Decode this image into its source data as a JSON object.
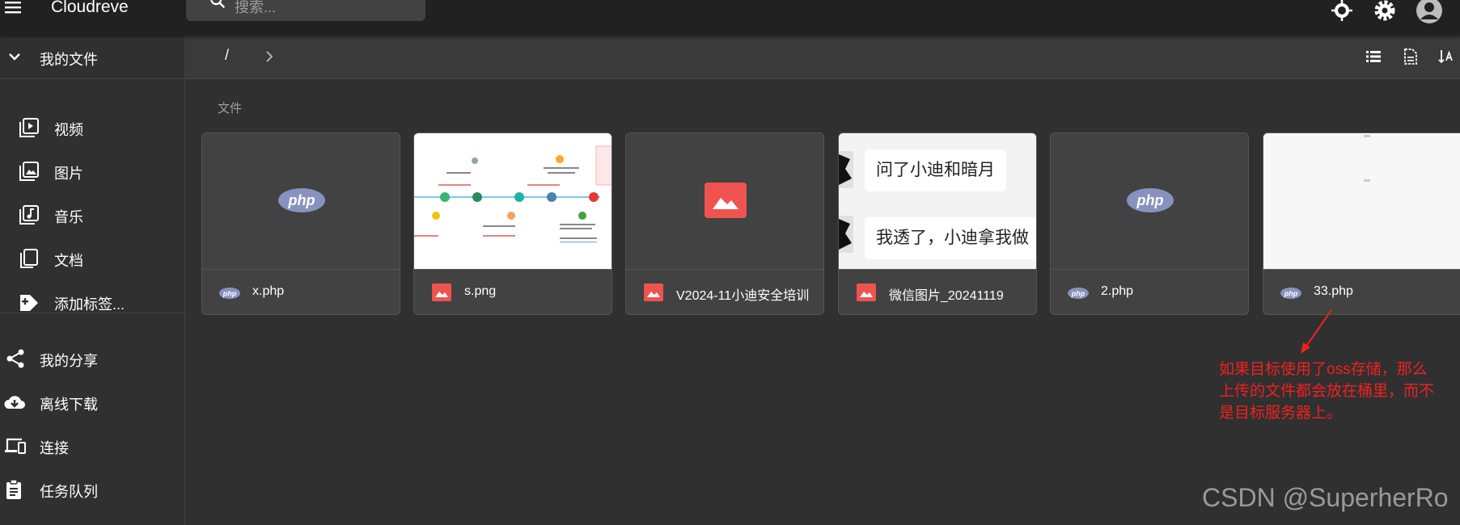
{
  "app": {
    "title": "Cloudreve"
  },
  "search": {
    "placeholder": "搜索..."
  },
  "sidebar": {
    "my_files": "我的文件",
    "categories": [
      {
        "label": "视频",
        "icon": "video-icon"
      },
      {
        "label": "图片",
        "icon": "image-icon"
      },
      {
        "label": "音乐",
        "icon": "music-icon"
      },
      {
        "label": "文档",
        "icon": "document-icon"
      },
      {
        "label": "添加标签...",
        "icon": "add-tag-icon"
      }
    ],
    "links": [
      {
        "label": "我的分享",
        "icon": "share-icon"
      },
      {
        "label": "离线下载",
        "icon": "cloud-download-icon"
      },
      {
        "label": "连接",
        "icon": "devices-icon"
      },
      {
        "label": "任务队列",
        "icon": "clipboard-icon"
      }
    ]
  },
  "toolbar": {
    "path": "/"
  },
  "files": {
    "section_label": "文件",
    "items": [
      {
        "name": "x.php",
        "type": "php"
      },
      {
        "name": "s.png",
        "type": "image"
      },
      {
        "name": "V2024-11小迪安全培训",
        "type": "image"
      },
      {
        "name": "微信图片_20241119",
        "type": "image"
      },
      {
        "name": "2.php",
        "type": "php"
      },
      {
        "name": "33.php",
        "type": "php"
      }
    ]
  },
  "chat_preview": {
    "line1": "问了小迪和暗月",
    "line2": "我透了，小迪拿我做"
  },
  "php_logo_text": "php",
  "annotation": {
    "text": "如果目标使用了oss存储，那么上传的文件都会放在桶里，而不是目标服务器上。"
  },
  "watermark": "CSDN @SuperherRo",
  "colors": {
    "appbar": "#212121",
    "background": "#303030",
    "card": "#424242",
    "image_icon": "#ef5350",
    "php_logo": "#8892bf",
    "annotation": "#f02020"
  }
}
